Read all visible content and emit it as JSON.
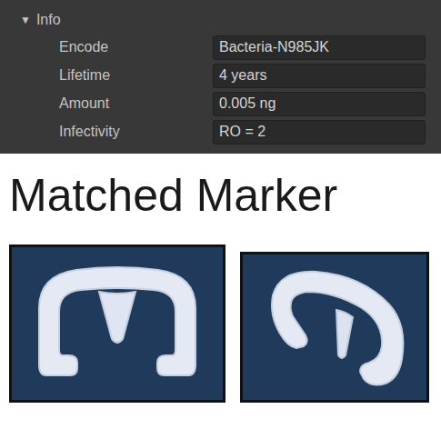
{
  "info": {
    "header": "Info",
    "arrow": "▼",
    "expanded": true,
    "fields": [
      {
        "label": "Encode",
        "value": "Bacteria-N985JK"
      },
      {
        "label": "Lifetime",
        "value": "4 years"
      },
      {
        "label": "Amount",
        "value": "0.005 ng"
      },
      {
        "label": "Infectivity",
        "value": "RO = 2"
      }
    ]
  },
  "title": "Matched Marker"
}
